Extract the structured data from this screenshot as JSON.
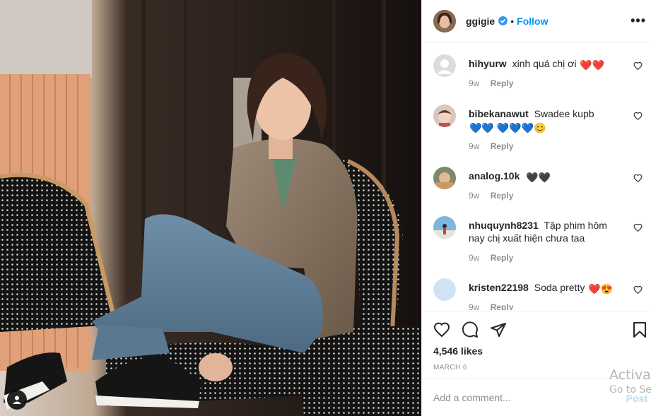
{
  "post": {
    "username": "ggigie",
    "follow_label": "Follow",
    "separator": "•",
    "more_label": "•••",
    "likes": "4,546 likes",
    "date": "MARCH 6",
    "comment_placeholder": "Add a comment...",
    "post_label": "Post"
  },
  "comments": [
    {
      "user": "hihyurw",
      "text": "xinh quá chị ơi",
      "emoji": "❤️❤️",
      "age": "9w",
      "reply": "Reply"
    },
    {
      "user": "bibekanawut",
      "text": "Swadee kupb",
      "emoji": "💙💙 💙💙💙😊",
      "age": "9w",
      "reply": "Reply"
    },
    {
      "user": "analog.10k",
      "text": "",
      "emoji": "🖤🖤",
      "age": "9w",
      "reply": "Reply"
    },
    {
      "user": "nhuquynh8231",
      "text": "Tập phim hôm nay chị xuất hiện chưa taa",
      "emoji": "",
      "age": "9w",
      "reply": "Reply"
    },
    {
      "user": "kristen22198",
      "text": "Soda pretty",
      "emoji": "❤️😍",
      "age": "9w",
      "reply": "Reply"
    }
  ],
  "watermark": {
    "line1": "Activat",
    "line2": "Go to Set"
  },
  "colors": {
    "accent": "#0095f6",
    "verified": "#3897f0",
    "muted": "#8e8e8e",
    "post_disabled": "#b2dffc"
  }
}
